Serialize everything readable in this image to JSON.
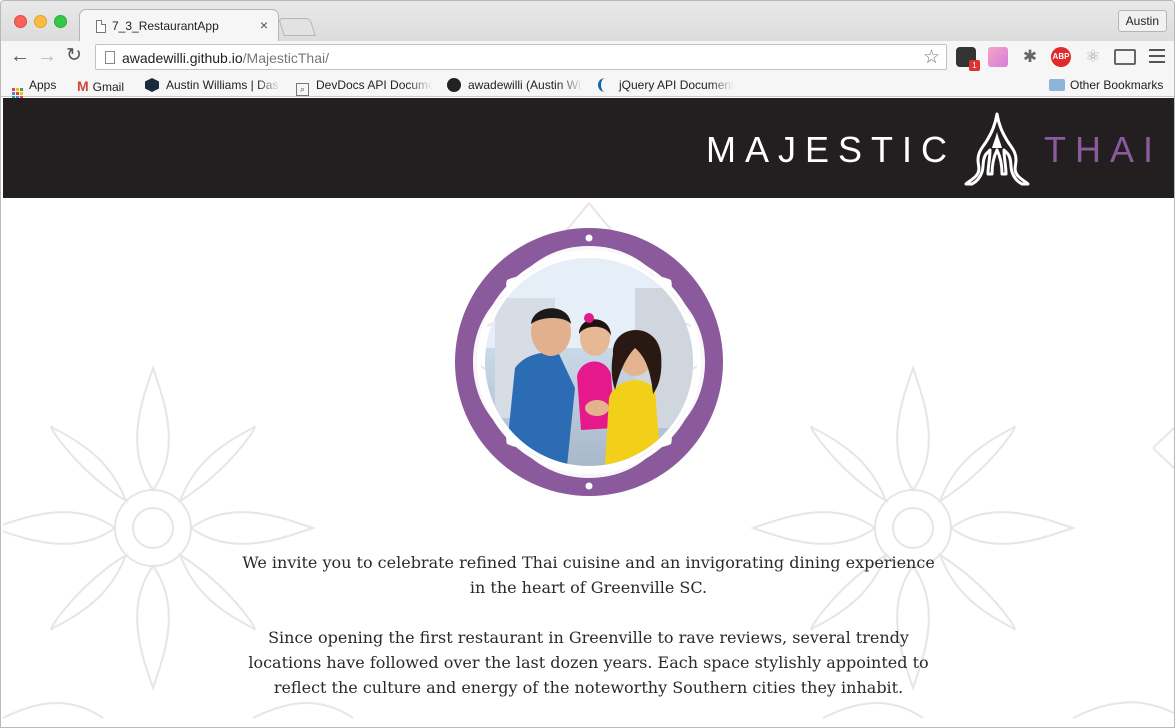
{
  "browser": {
    "tab_title": "7_3_RestaurantApp",
    "tab_close": "×",
    "profile_name": "Austin",
    "url_host": "awadewilli.github.io",
    "url_path": "/MajesticThai/",
    "nav": {
      "back": "←",
      "forward": "→",
      "reload": "↻",
      "star": "☆"
    },
    "extensions": [
      "pocket-icon",
      "palette-icon",
      "bug-icon",
      "adblock-icon",
      "react-icon",
      "cast-icon"
    ],
    "adblock_label": "ABP",
    "pocket_badge": "1",
    "bookmarks": {
      "apps": "Apps",
      "gmail": "Gmail",
      "austin": "Austin Williams | Das",
      "devdocs": "DevDocs API Docume",
      "github": "awadewilli (Austin Wi",
      "jquery": "jQuery API Document",
      "other": "Other Bookmarks"
    }
  },
  "site": {
    "logo_word1": "MAJESTIC",
    "logo_word2": "THAI",
    "colors": {
      "header_bg": "#231f20",
      "accent_purple": "#8a5a9c",
      "pattern_line": "#e8e4ea"
    },
    "intro": "We invite you to celebrate refined Thai cuisine and an invigorating dining experience in the heart of Greenville SC.",
    "intro_line1": "We invite you to celebrate refined Thai cuisine and an invigorating dining experience",
    "intro_line2": "in the heart of Greenville SC.",
    "about_line1": "Since opening the first restaurant in Greenville to rave reviews, several trendy",
    "about_line2": "locations have followed over the last dozen years. Each space stylishly appointed to",
    "about_line3": "reflect the culture and energy of the noteworthy Southern cities they inhabit."
  }
}
